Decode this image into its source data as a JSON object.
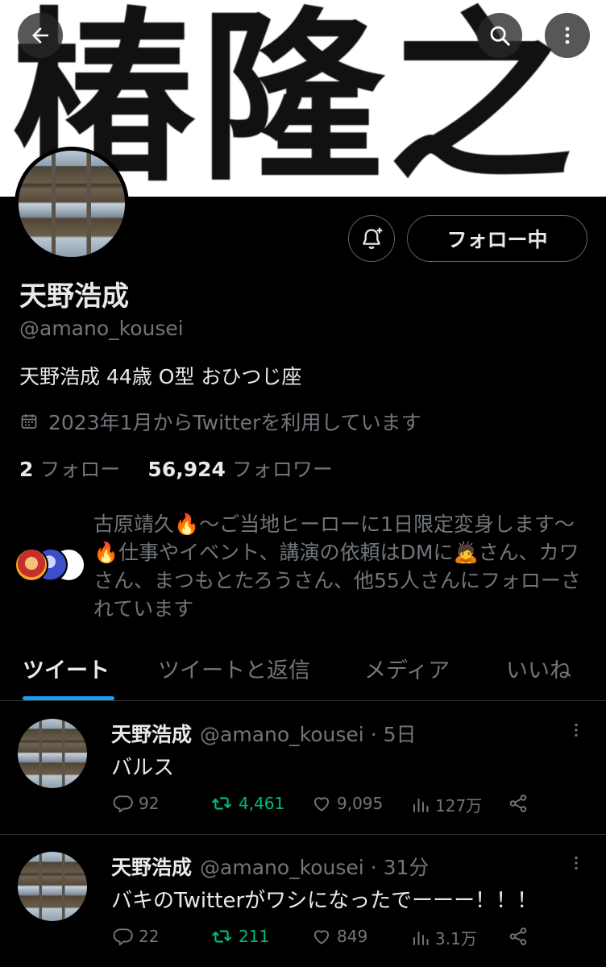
{
  "banner": {
    "text": "椿隆之"
  },
  "profile": {
    "display_name": "天野浩成",
    "handle": "@amano_kousei",
    "bio": "天野浩成 44歳 O型 おひつじ座",
    "joined": "2023年1月からTwitterを利用しています",
    "following_count": "2",
    "following_label": "フォロー",
    "followers_count": "56,924",
    "followers_label": "フォロワー",
    "follow_button_label": "フォロー中",
    "followed_by_text": "古原靖久🔥〜ご当地ヒーローに1日限定変身します〜🔥仕事やイベント、講演の依頼はDMに🙇さん、カワさん、まつもとたろうさん、他55人さんにフォローされています"
  },
  "icons": {
    "back": "arrow-left-icon",
    "search": "search-icon",
    "more": "more-vertical-icon",
    "notify": "bell-plus-icon",
    "calendar": "calendar-icon",
    "reply": "reply-icon",
    "retweet": "retweet-icon",
    "like": "heart-icon",
    "views": "views-icon",
    "share": "share-icon"
  },
  "tabs": [
    {
      "label": "ツイート",
      "active": true
    },
    {
      "label": "ツイートと返信",
      "active": false
    },
    {
      "label": "メディア",
      "active": false
    },
    {
      "label": "いいね",
      "active": false
    }
  ],
  "tweets": [
    {
      "name": "天野浩成",
      "handle": "@amano_kousei",
      "time": "· 5日",
      "text": "バルス",
      "replies": "92",
      "retweets": "4,461",
      "likes": "9,095",
      "views": "127万"
    },
    {
      "name": "天野浩成",
      "handle": "@amano_kousei",
      "time": "· 31分",
      "text": "バキのTwitterがワシになったでーーー！！！",
      "replies": "22",
      "retweets": "211",
      "likes": "849",
      "views": "3.1万"
    }
  ],
  "colors": {
    "background": "#000000",
    "text_primary": "#e7e9ea",
    "text_secondary": "#71767b",
    "accent": "#1d9bf0",
    "retweet_active": "#00ba7c",
    "border": "#2f3336"
  }
}
